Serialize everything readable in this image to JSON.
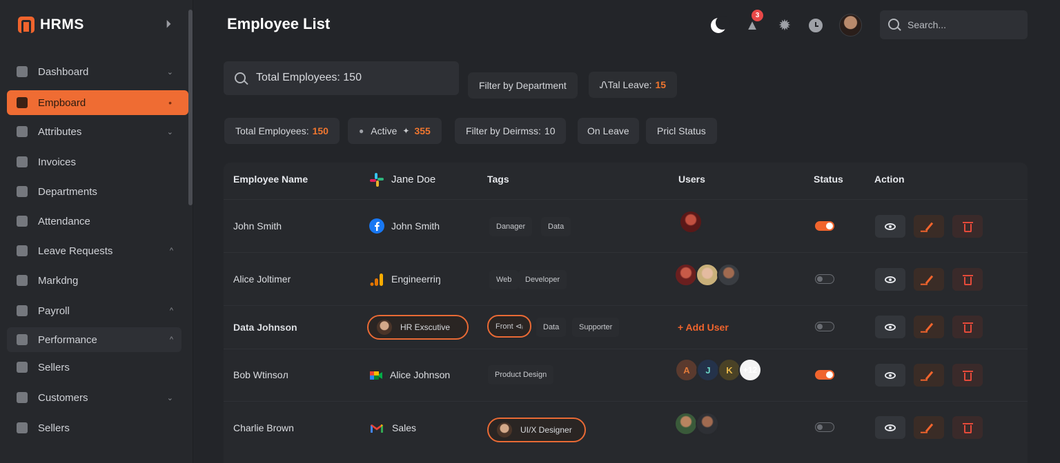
{
  "app": {
    "name": "HRMS"
  },
  "sidebar": {
    "items": [
      {
        "label": "Dashboard",
        "chevron": "⌄"
      },
      {
        "label": "Empboard",
        "chevron": "•"
      },
      {
        "label": "Attributes",
        "chevron": "⌄"
      },
      {
        "label": "Invoices",
        "chevron": ""
      },
      {
        "label": "Departments",
        "chevron": ""
      },
      {
        "label": "Attendance",
        "chevron": ""
      },
      {
        "label": "Leave Requests",
        "chevron": "^"
      },
      {
        "label": "Markdng",
        "chevron": ""
      },
      {
        "label": "Payroll",
        "chevron": "^"
      },
      {
        "label": "Performance",
        "chevron": "^"
      },
      {
        "label": "Sellers",
        "chevron": ""
      },
      {
        "label": "Customers",
        "chevron": "⌄"
      },
      {
        "label": "Sellers",
        "chevron": ""
      }
    ]
  },
  "header": {
    "title": "Employee List",
    "notification_count": "3",
    "search_placeholder": "Search..."
  },
  "toolbar": {
    "search_text": "Total Employees: 150",
    "filter_department": "Filter by Department",
    "total_leave_label": "ᏁTal Leave:",
    "total_leave_value": "15"
  },
  "filters": {
    "total_label": "Total Employees:",
    "total_value": "150",
    "active_label": "Active",
    "active_value": "355",
    "filter_deirmss_label": "Filter by Deirmss:",
    "filter_deirmss_value": "10",
    "on_leave": "On Leave",
    "status": "Pricl Status"
  },
  "table": {
    "headers": {
      "name": "Employee Name",
      "second": "Jane Doe",
      "tags": "Tags",
      "users": "Users",
      "status": "Status",
      "action": "Action"
    },
    "rows": [
      {
        "name": "John Smith",
        "second": "John Smith",
        "tags": [
          "Danager",
          "Data"
        ],
        "status_on": true
      },
      {
        "name": "Alice Joltimer",
        "second": "Engineerriŋ",
        "tags": [
          "Web",
          "Developer"
        ],
        "status_on": false
      },
      {
        "name": "Data Johnson",
        "second": "HR Exscutive",
        "tags": [
          "Front ⊲ᵢ",
          "Data",
          "Supporter"
        ],
        "users_action": "+ Add User",
        "status_on": false
      },
      {
        "name": "Bob Wtinsoл",
        "second": "Alice Johnson",
        "tags": [
          "Product Design"
        ],
        "users_letters": [
          "A",
          "J",
          "K",
          "+12"
        ],
        "status_on": true
      },
      {
        "name": "Charlie Brown",
        "second": "Sales",
        "tags": [
          "UI/X Designer"
        ],
        "status_on": false
      }
    ]
  },
  "colors": {
    "accent": "#f0642d",
    "background": "#232529",
    "panel": "#2e3035"
  }
}
